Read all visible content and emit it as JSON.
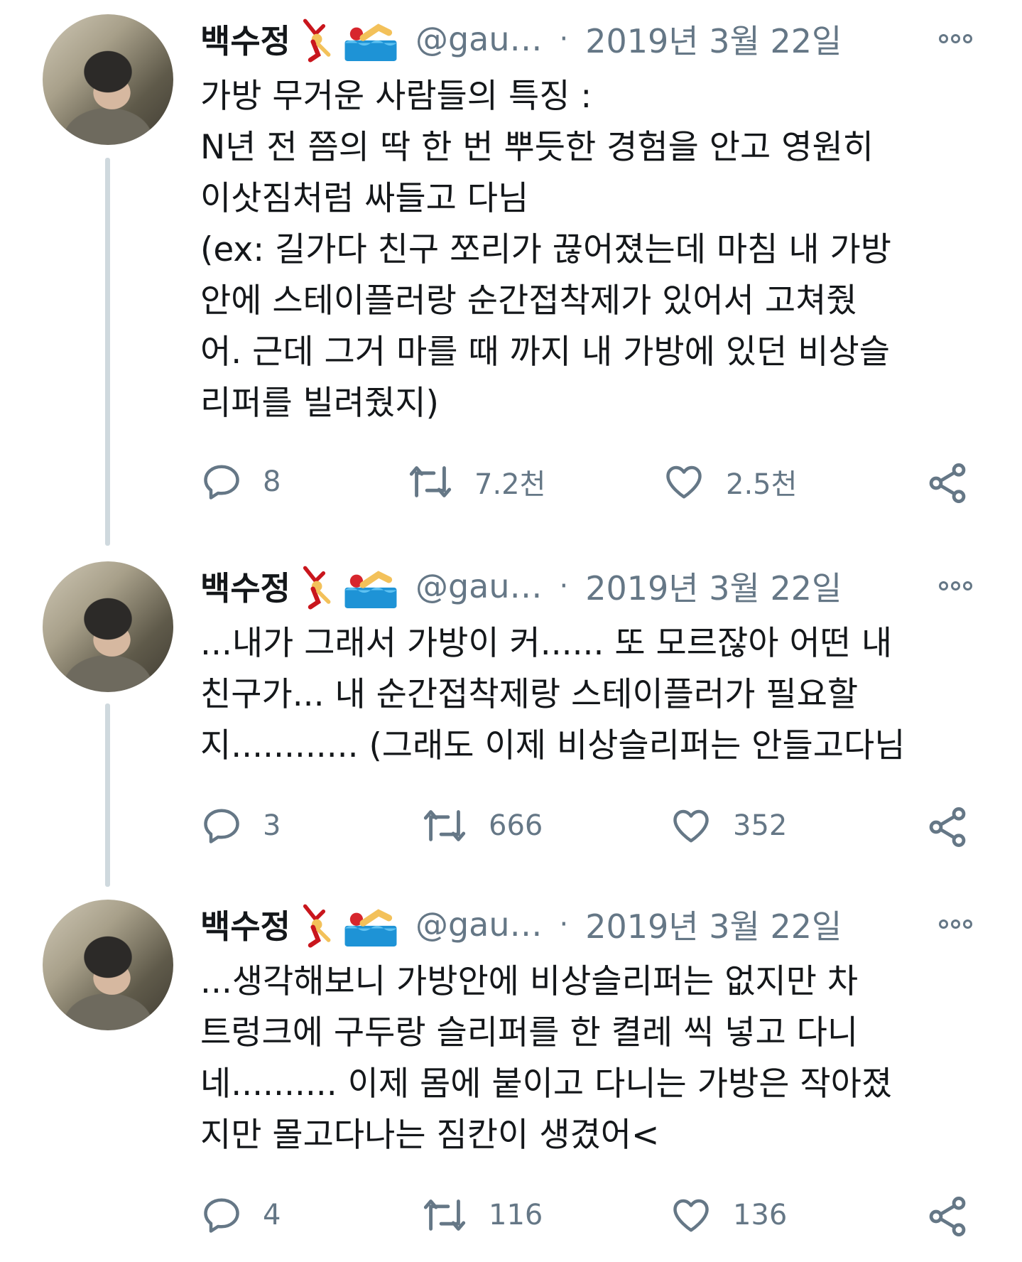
{
  "tweets": [
    {
      "name": "백수정",
      "handle": "@gau…",
      "separator": "·",
      "date": "2019년 3월 22일",
      "lines": [
        "가방 무거운 사람들의 특징 :",
        "N년 전 쯤의 딱 한 번 뿌듯한 경험을 안고 영원히",
        "이삿짐처럼 싸들고 다님",
        "(ex: 길가다 친구 쪼리가 끊어졌는데 마침 내 가방",
        "안에 스테이플러랑 순간접착제가 있어서 고쳐줬",
        "어. 근데 그거 마를 때 까지 내 가방에 있던 비상슬",
        "리퍼를 빌려줬지)"
      ],
      "replies": "8",
      "retweets": "7.2천",
      "likes": "2.5천"
    },
    {
      "name": "백수정",
      "handle": "@gau…",
      "separator": "·",
      "date": "2019년 3월 22일",
      "lines": [
        "...내가 그래서 가방이 커...... 또 모르잖아 어떤  내",
        "친구가... 내 순간접착제랑 스테이플러가 필요할",
        "지............ (그래도 이제 비상슬리퍼는 안들고다님"
      ],
      "replies": "3",
      "retweets": "666",
      "likes": "352"
    },
    {
      "name": "백수정",
      "handle": "@gau…",
      "separator": "·",
      "date": "2019년 3월 22일",
      "lines": [
        "...생각해보니 가방안에 비상슬리퍼는 없지만 차",
        "트렁크에 구두랑 슬리퍼를 한 켤레 씩 넣고 다니",
        "네.......... 이제 몸에 붙이고 다니는 가방은 작아졌",
        "지만 몰고다나는 짐칸이 생겼어<"
      ],
      "replies": "4",
      "retweets": "116",
      "likes": "136"
    }
  ],
  "icons": {
    "reply": "reply-bubble-icon",
    "retweet": "retweet-arrows-icon",
    "like": "heart-icon",
    "share": "share-icon",
    "more": "more-options-icon",
    "emoji_1": "dancer-emoji",
    "emoji_2": "swimmer-emoji"
  },
  "colors": {
    "text": "#14171a",
    "secondary": "#657786",
    "thread_line": "#cfd9de"
  }
}
